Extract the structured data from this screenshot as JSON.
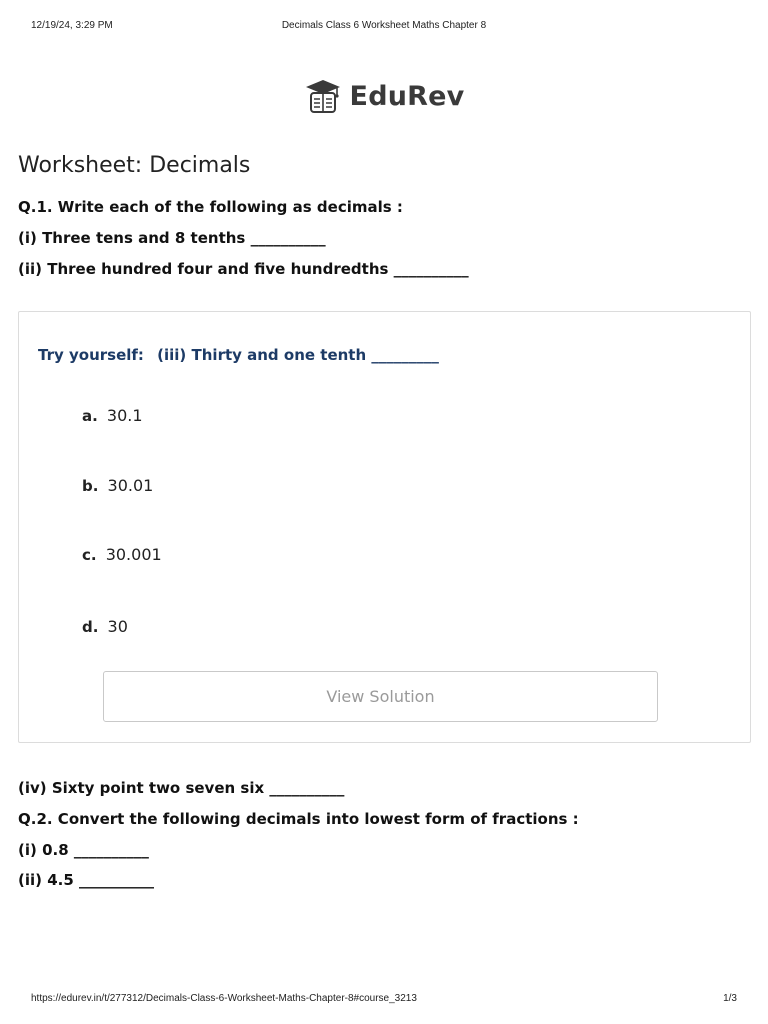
{
  "print_header": {
    "date": "12/19/24, 3:29 PM",
    "title": "Decimals Class 6 Worksheet Maths Chapter 8"
  },
  "logo": {
    "icon": "graduation-cap-book-icon",
    "text": "EduRev"
  },
  "page_title": "Worksheet: Decimals",
  "q1": {
    "heading": "Q.1. Write each of the following as decimals :",
    "items": [
      "(i) Three tens and 8 tenths __________",
      "(ii) Three hundred four and five hundredths __________"
    ]
  },
  "try_yourself": {
    "label": "Try yourself:",
    "question": "(iii) Thirty and one tenth _________",
    "options": [
      {
        "letter": "a.",
        "value": "30.1"
      },
      {
        "letter": "b.",
        "value": "30.01"
      },
      {
        "letter": "c.",
        "value": "30.001"
      },
      {
        "letter": "d.",
        "value": "30"
      }
    ],
    "button_label": "View Solution"
  },
  "q1_continued": [
    "(iv) Sixty point two seven six __________"
  ],
  "q2": {
    "heading": "Q.2. Convert the following decimals into lowest form of fractions :",
    "items": [
      "(i) 0.8 __________",
      "(ii) 4.5 __________"
    ]
  },
  "print_footer": {
    "url": "https://edurev.in/t/277312/Decimals-Class-6-Worksheet-Maths-Chapter-8#course_3213",
    "page": "1/3"
  },
  "colors": {
    "accent_blue": "#1d3b66",
    "button_text": "#9a9a9a",
    "border": "#dcdcdc"
  }
}
